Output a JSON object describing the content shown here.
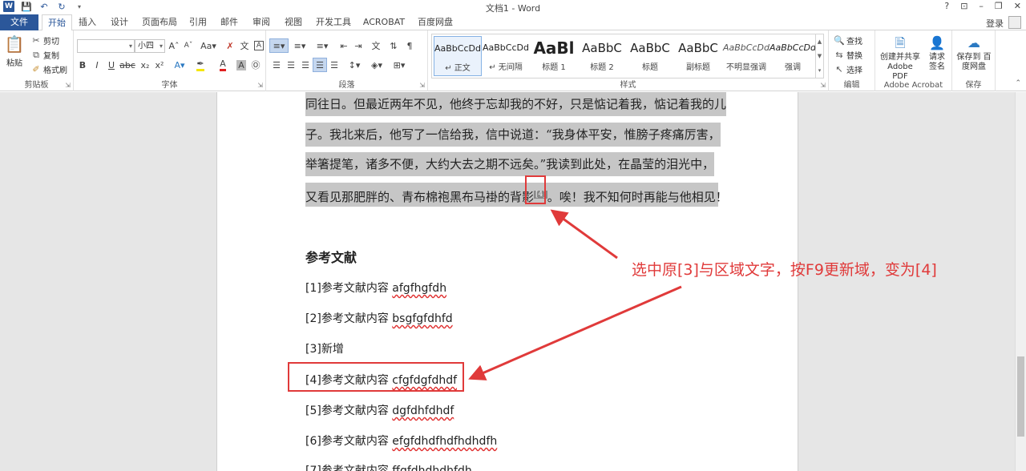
{
  "window": {
    "title": "文档1 - Word",
    "controls": [
      "?",
      "⊡",
      "–",
      "❐",
      "✕"
    ]
  },
  "tabs": [
    "文件",
    "开始",
    "插入",
    "设计",
    "页面布局",
    "引用",
    "邮件",
    "审阅",
    "视图",
    "开发工具",
    "ACROBAT",
    "百度网盘"
  ],
  "account": {
    "login": "登录"
  },
  "ribbon": {
    "clipboard": {
      "label": "剪贴板",
      "paste": "粘贴",
      "cut": "剪切",
      "copy": "复制",
      "format_painter": "格式刷"
    },
    "font": {
      "label": "字体",
      "font_name": "",
      "font_size": "小四"
    },
    "paragraph": {
      "label": "段落"
    },
    "styles": {
      "label": "样式",
      "items": [
        {
          "preview": "AaBbCcDd",
          "name": "↵ 正文"
        },
        {
          "preview": "AaBbCcDd",
          "name": "↵ 无间隔"
        },
        {
          "preview": "AaBl",
          "name": "标题 1"
        },
        {
          "preview": "AaBbC",
          "name": "标题 2"
        },
        {
          "preview": "AaBbC",
          "name": "标题"
        },
        {
          "preview": "AaBbC",
          "name": "副标题"
        },
        {
          "preview": "AaBbCcDd",
          "name": "不明显强调"
        },
        {
          "preview": "AaBbCcDd",
          "name": "强调"
        }
      ]
    },
    "editing": {
      "label": "编辑",
      "find": "查找",
      "replace": "替换",
      "select": "选择"
    },
    "acrobat": {
      "label": "Adobe Acrobat",
      "create_pdf": "创建并共享 Adobe PDF",
      "request_sign": "请求 签名"
    },
    "save": {
      "label": "保存",
      "save_baidu": "保存到 百度网盘"
    }
  },
  "document": {
    "paragraph_lines": [
      "同往日。但最近两年不见，他终于忘却我的不好，只是惦记着我，惦记着我的儿",
      "子。我北来后，他写了一信给我，信中说道：“我身体平安，惟膀子疼痛厉害，",
      "举箸提笔，诸多不便，大约大去之期不远矣。”我读到此处，在晶莹的泪光中，",
      "又看见那肥胖的、青布棉袍黑布马褂的背影[4]。唉！我不知何时再能与他相见！"
    ],
    "line4_before": "又看见那肥胖的、青布棉袍黑布马褂的背影",
    "line4_field": "[4]",
    "line4_after": "。唉！我不知何时再能与他相见！",
    "heading": "参考文献",
    "references": [
      {
        "num": "[1]",
        "text": "参考文献内容 ",
        "code": "afgfhgfdh"
      },
      {
        "num": "[2]",
        "text": "参考文献内容 ",
        "code": "bsgfgfdhfd"
      },
      {
        "num": "[3]",
        "text": "新增",
        "code": ""
      },
      {
        "num": "[4]",
        "text": "参考文献内容 ",
        "code": "cfgfdgfdhdf"
      },
      {
        "num": "[5]",
        "text": "参考文献内容 ",
        "code": "dgfdhfdhdf"
      },
      {
        "num": "[6]",
        "text": "参考文献内容 ",
        "code": "efgfdhdfhdfhdhdfh"
      },
      {
        "num": "[7]",
        "text": "参考文献内容 ",
        "code": "ffgfdhdhdhfdh"
      }
    ]
  },
  "annotation": {
    "text": "选中原[3]与区域文字，按F9更新域，变为[4]",
    "color": "#e03a3a"
  }
}
